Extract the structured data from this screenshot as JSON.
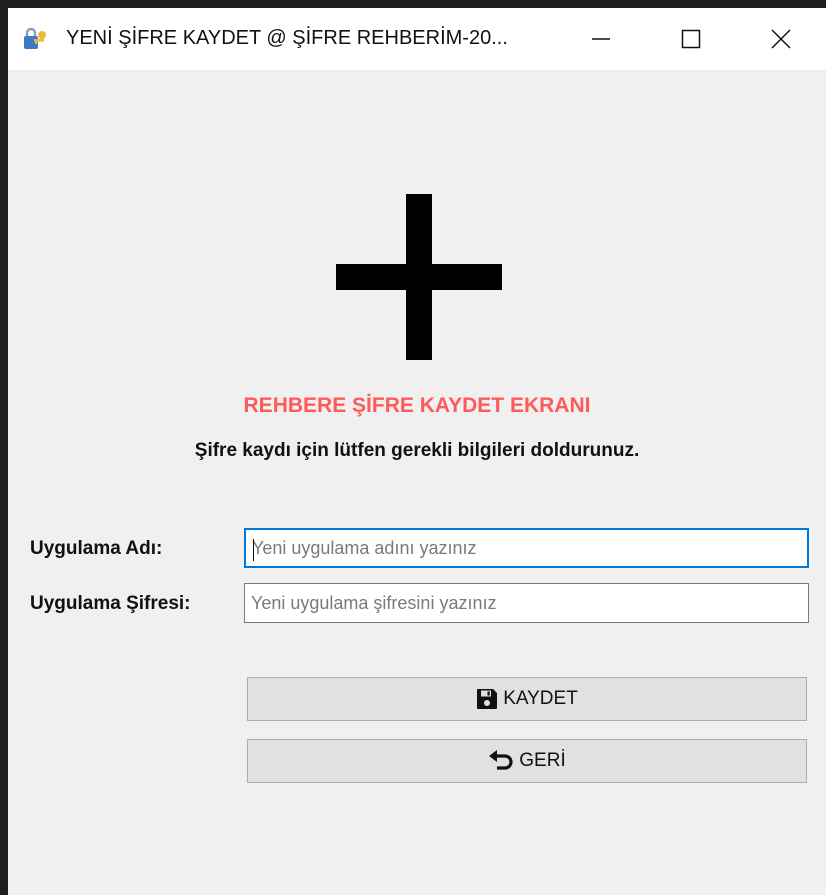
{
  "window": {
    "title": "YENİ ŞİFRE KAYDET @ ŞİFRE REHBERİM-20...",
    "icon": "key-lock-icon",
    "controls": [
      "minimize-icon",
      "maximize-icon",
      "close-icon"
    ]
  },
  "main": {
    "hero_icon": "plus-icon",
    "title": "REHBERE ŞİFRE KAYDET EKRANI",
    "subtitle": "Şifre kaydı için lütfen gerekli bilgileri doldurunuz."
  },
  "form": {
    "app_name_label": "Uygulama Adı:",
    "app_name_value": "",
    "app_name_placeholder": "Yeni uygulama adını yazınız",
    "app_password_label": "Uygulama Şifresi:",
    "app_password_value": "",
    "app_password_placeholder": "Yeni uygulama şifresini yazınız"
  },
  "actions": {
    "save_label": "KAYDET",
    "save_icon": "floppy-disk-icon",
    "back_label": "GERİ",
    "back_icon": "undo-arrow-icon"
  },
  "colors": {
    "title_accent": "#ff5a5a",
    "focus_border": "#0078d7",
    "window_bg": "#f0f0f0"
  }
}
